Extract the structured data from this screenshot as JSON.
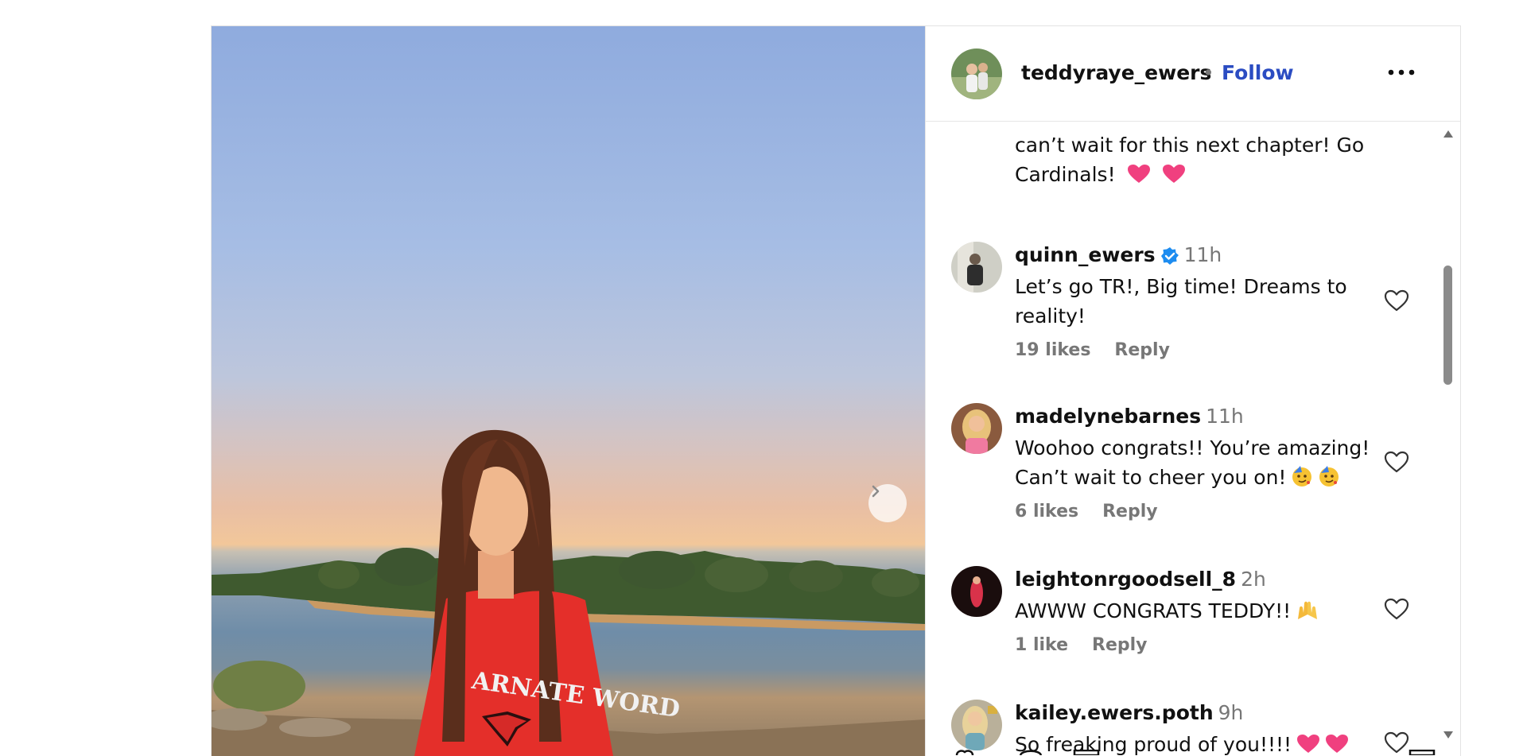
{
  "post": {
    "username": "teddyraye_ewers",
    "separator": "•",
    "follow_label": "Follow",
    "more_icon": "more-horizontal-icon",
    "caption_tail_line1": "can’t wait for this next chapter! Go",
    "caption_tail_line2": "Cardinals!",
    "image_shirt_text": "ARNATE WORD"
  },
  "comments": [
    {
      "username": "quinn_ewers",
      "verified": true,
      "time": "11h",
      "line1": "Let’s go TR!, Big time! Dreams to",
      "line2": "reality!",
      "likes": "19 likes",
      "reply": "Reply"
    },
    {
      "username": "madelynebarnes",
      "time": "11h",
      "line1": "Woohoo congrats!! You’re amazing!",
      "line2": "Can’t wait to cheer you on!",
      "likes": "6 likes",
      "reply": "Reply"
    },
    {
      "username": "leightonrgoodsell_8",
      "time": "2h",
      "line1": "AWWW CONGRATS TEDDY!!",
      "likes": "1 like",
      "reply": "Reply"
    },
    {
      "username": "kailey.ewers.poth",
      "time": "9h",
      "line1": "So freaking proud of you!!!!"
    }
  ],
  "colors": {
    "follow": "#2b4cc2",
    "muted": "#777777",
    "heart_emoji": "#f0407f",
    "verified": "#1d8cf0"
  }
}
